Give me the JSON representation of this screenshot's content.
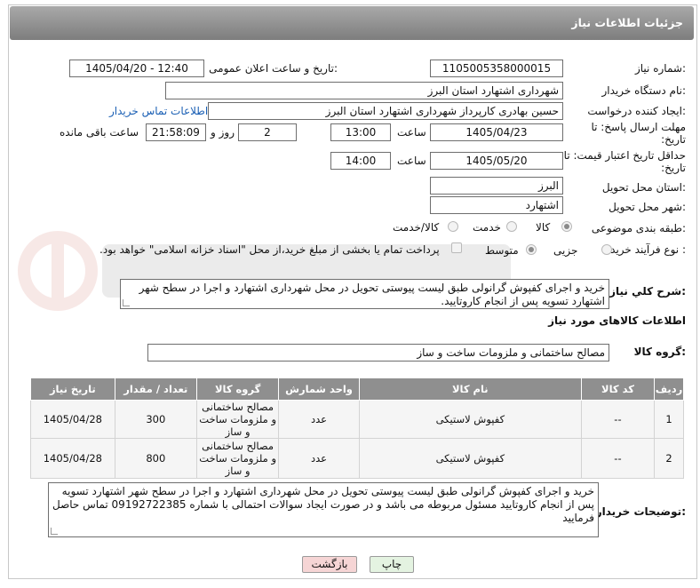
{
  "header": {
    "title": "جزئیات اطلاعات نیاز"
  },
  "form": {
    "need_number_label": "شماره نیاز:",
    "need_number": "1105005358000015",
    "announce_label": "تاریخ و ساعت اعلان عمومی:",
    "announce_value": "1405/04/20 - 12:40",
    "buyer_org_label": "نام دستگاه خریدار:",
    "buyer_org": "شهرداری اشتهارد استان البرز",
    "requester_label": "ایجاد کننده درخواست:",
    "requester": "حسین بهادری کارپرداز شهرداری اشتهارد استان البرز",
    "contact_link": "اطلاعات تماس خریدار",
    "reply_deadline_label": "مهلت ارسال پاسخ: تا تاریخ:",
    "reply_date": "1405/04/23",
    "time_label": "ساعت",
    "reply_time": "13:00",
    "days_value": "2",
    "days_label": "روز و",
    "remaining_time": "21:58:09",
    "remaining_label": "ساعت باقی مانده",
    "validity_label": "حداقل تاریخ اعتبار قیمت: تا تاریخ:",
    "validity_date": "1405/05/20",
    "validity_time": "14:00",
    "province_label": "استان محل تحویل:",
    "province": "البرز",
    "city_label": "شهر محل تحویل:",
    "city": "اشتهارد",
    "category_label": "طبقه بندی موضوعی:",
    "category_options": [
      "کالا",
      "خدمت",
      "کالا/خدمت"
    ],
    "process_label": "نوع فرآیند خرید :",
    "process_options": [
      "جزیی",
      "متوسط"
    ],
    "payment_text": "پرداخت تمام یا بخشی از مبلغ خرید،از محل \"اسناد خزانه اسلامی\" خواهد بود."
  },
  "summary": {
    "label": "شرح کلي نياز:",
    "text": "خرید و اجرای کفپوش گرانولی طبق لیست پیوستی تحویل در محل شهرداری اشتهارد و اجرا در سطح شهر اشتهارد تسویه پس از انجام کاروتایید."
  },
  "goods": {
    "section_title": "اطلاعات کالاهای مورد نیاز",
    "group_label": "گروه کالا:",
    "group_value": "مصالح ساختمانی و ملزومات ساخت و ساز"
  },
  "table": {
    "headers": [
      "ردیف",
      "کد کالا",
      "نام کالا",
      "واحد شمارش",
      "گروه کالا",
      "تعداد / مقدار",
      "تاریخ نیاز"
    ],
    "rows": [
      [
        "1",
        "--",
        "کفپوش لاستیکی",
        "عدد",
        "مصالح ساختمانی و ملزومات ساخت و ساز",
        "300",
        "1405/04/28"
      ],
      [
        "2",
        "--",
        "کفپوش لاستیکی",
        "عدد",
        "مصالح ساختمانی و ملزومات ساخت و ساز",
        "800",
        "1405/04/28"
      ]
    ]
  },
  "buyer_notes": {
    "label": "توضیحات خریدار:",
    "text": "خرید و اجرای کفپوش گرانولی طبق لیست پیوستی تحویل در محل شهرداری اشتهارد و اجرا در سطح شهر اشتهارد تسویه پس از انجام کاروتایید مسئول مربوطه می باشد و در صورت ایجاد سوالات احتمالی با شماره 09192722385 تماس حاصل فرمایید"
  },
  "buttons": {
    "print": "چاپ",
    "back": "بازگشت"
  },
  "colors": {
    "header": "#8c8c8c",
    "back_button": "#f6d5d5",
    "print_button": "#e4f3e1",
    "link": "#1a5fb4"
  }
}
